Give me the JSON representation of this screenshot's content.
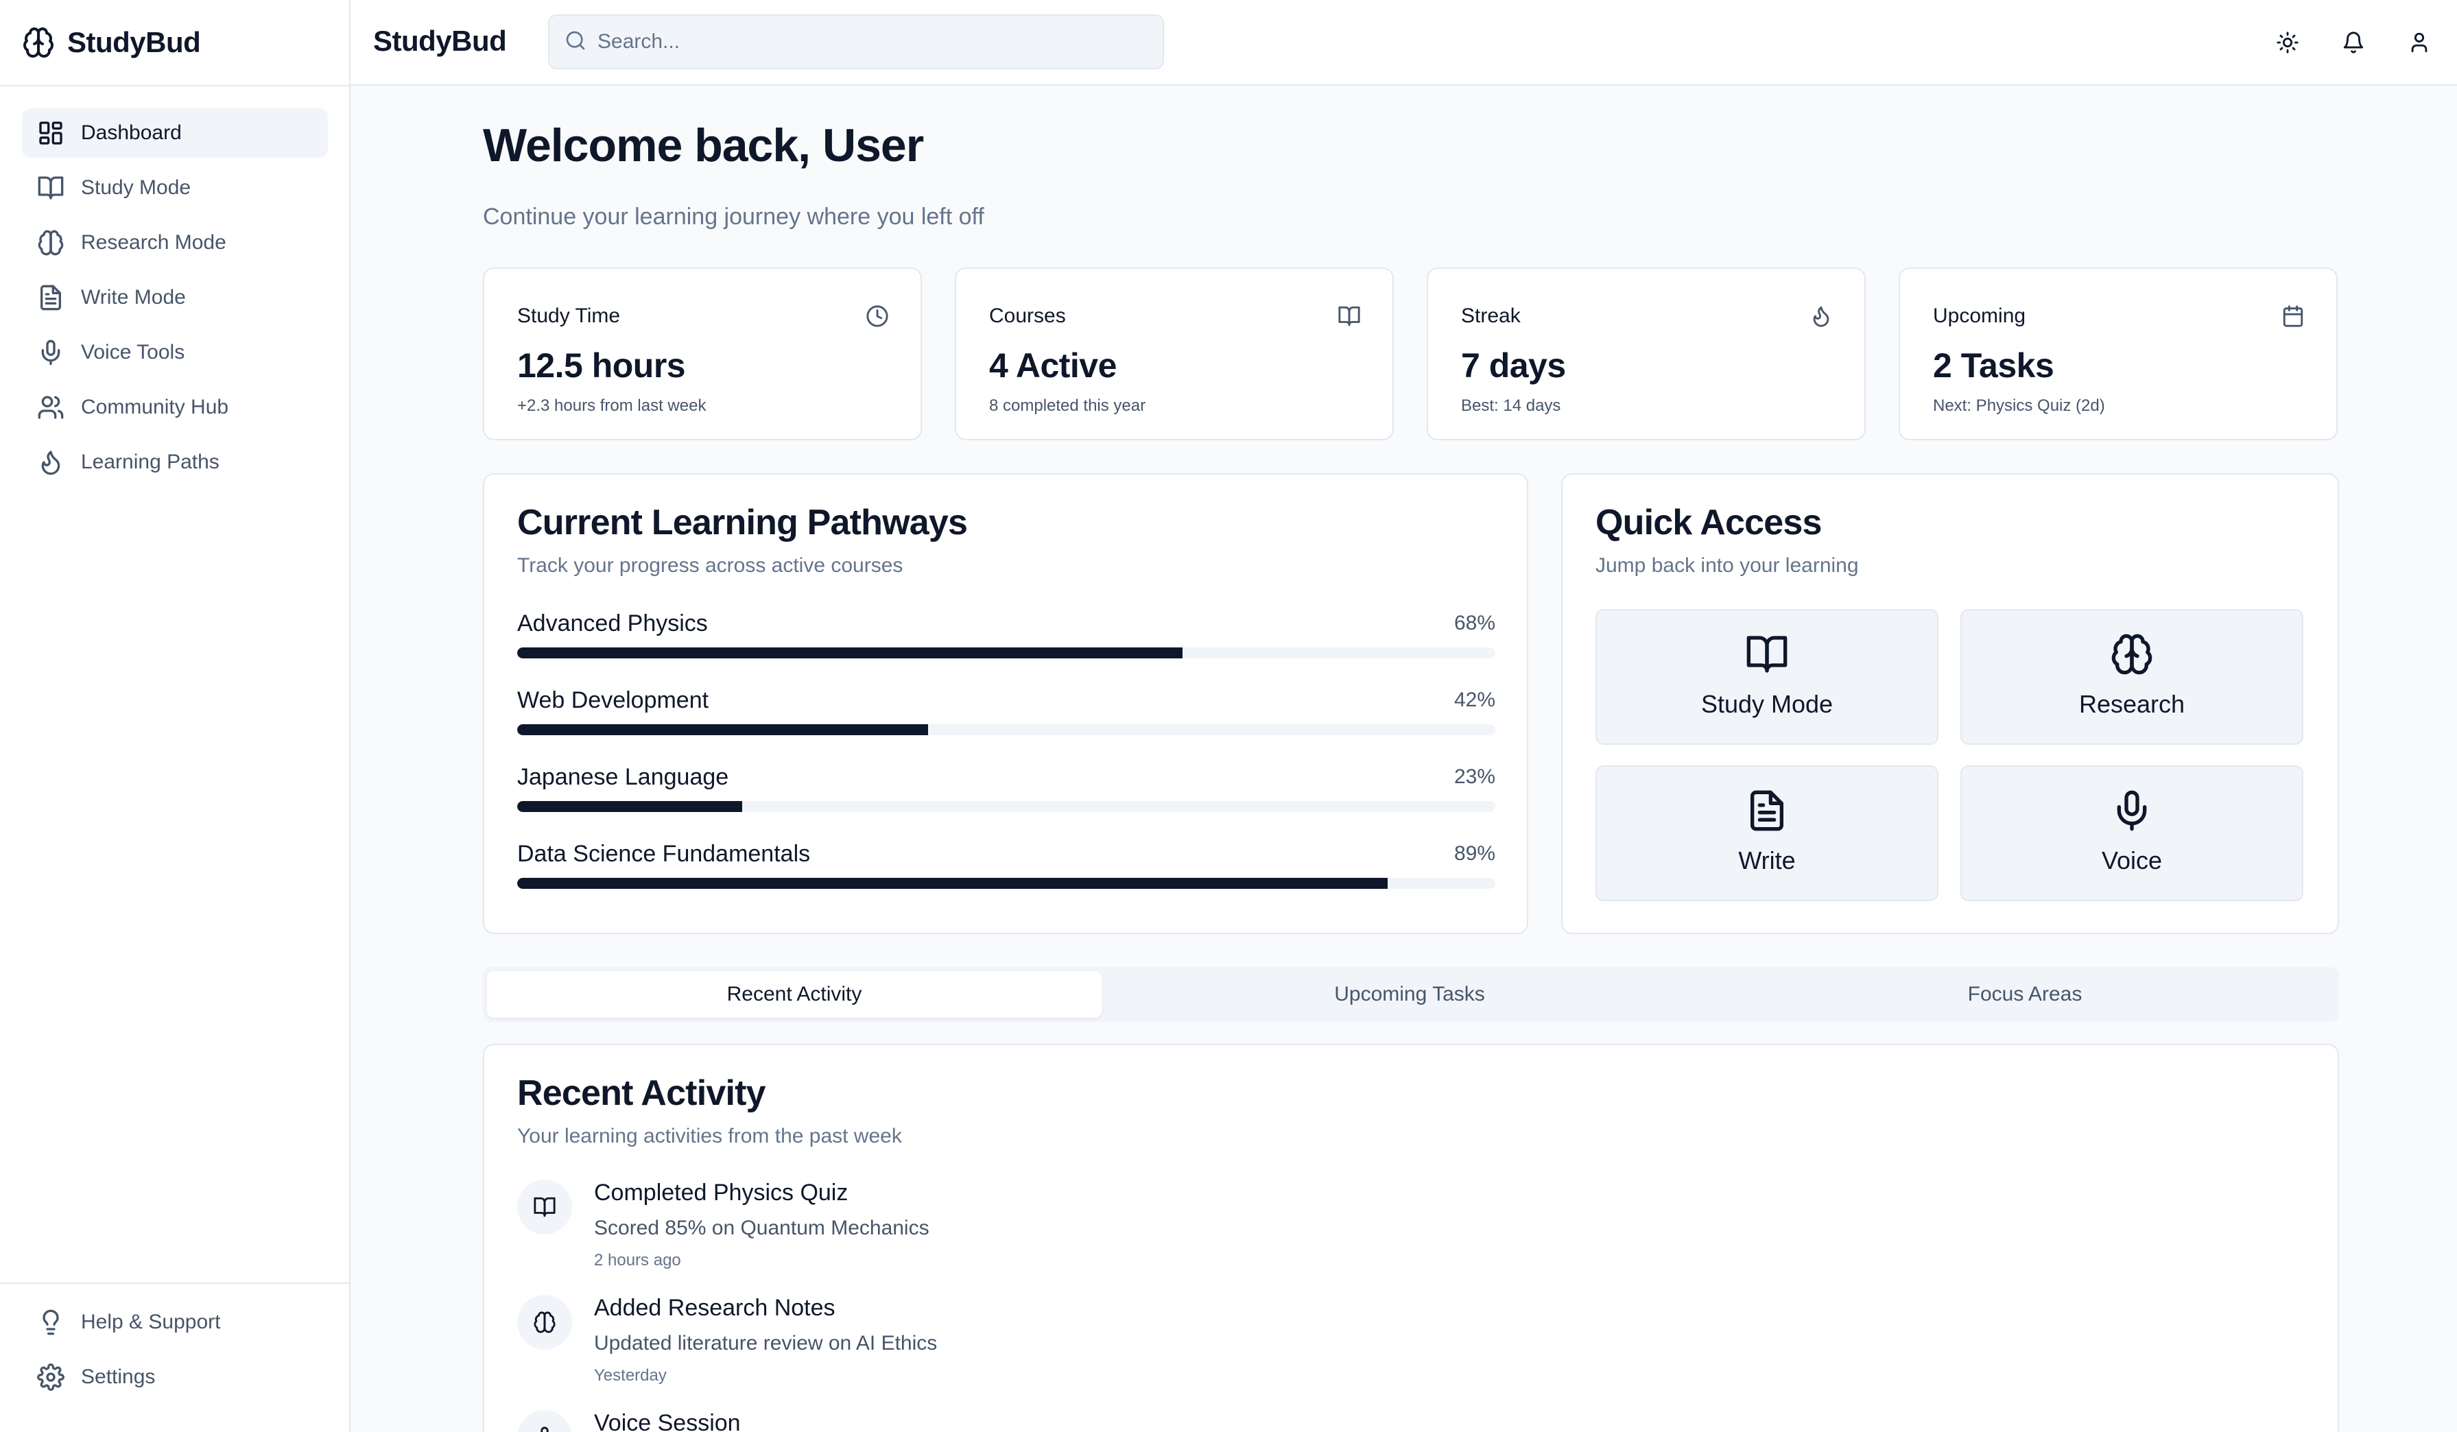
{
  "app": {
    "name": "StudyBud"
  },
  "sidebar": {
    "items": [
      {
        "label": "Dashboard",
        "icon": "dashboard-icon"
      },
      {
        "label": "Study Mode",
        "icon": "book-icon"
      },
      {
        "label": "Research Mode",
        "icon": "brain-icon"
      },
      {
        "label": "Write Mode",
        "icon": "document-icon"
      },
      {
        "label": "Voice Tools",
        "icon": "microphone-icon"
      },
      {
        "label": "Community Hub",
        "icon": "users-icon"
      },
      {
        "label": "Learning Paths",
        "icon": "flame-icon"
      }
    ],
    "active": "Dashboard",
    "bottom": [
      {
        "label": "Help & Support",
        "icon": "lightbulb-icon"
      },
      {
        "label": "Settings",
        "icon": "gear-icon"
      }
    ]
  },
  "header": {
    "title": "StudyBud",
    "search_placeholder": "Search...",
    "icons": [
      "sun-icon",
      "bell-icon",
      "user-icon"
    ]
  },
  "welcome": {
    "title": "Welcome back, User",
    "subtitle": "Continue your learning journey where you left off"
  },
  "stats": [
    {
      "label": "Study Time",
      "value": "12.5 hours",
      "note": "+2.3 hours from last week",
      "icon": "clock-icon"
    },
    {
      "label": "Courses",
      "value": "4 Active",
      "note": "8 completed this year",
      "icon": "book-icon"
    },
    {
      "label": "Streak",
      "value": "7 days",
      "note": "Best: 14 days",
      "icon": "flame-icon"
    },
    {
      "label": "Upcoming",
      "value": "2 Tasks",
      "note": "Next: Physics Quiz (2d)",
      "icon": "calendar-icon"
    }
  ],
  "pathways": {
    "title": "Current Learning Pathways",
    "subtitle": "Track your progress across active courses",
    "items": [
      {
        "name": "Advanced Physics",
        "percent_label": "68%",
        "progress": 68
      },
      {
        "name": "Web Development",
        "percent_label": "42%",
        "progress": 42
      },
      {
        "name": "Japanese Language",
        "percent_label": "23%",
        "progress": 23
      },
      {
        "name": "Data Science Fundamentals",
        "percent_label": "89%",
        "progress": 89
      }
    ]
  },
  "quick_access": {
    "title": "Quick Access",
    "subtitle": "Jump back into your learning",
    "buttons": [
      {
        "label": "Study Mode",
        "icon": "book-icon"
      },
      {
        "label": "Research",
        "icon": "brain-icon"
      },
      {
        "label": "Write",
        "icon": "document-icon"
      },
      {
        "label": "Voice",
        "icon": "microphone-icon"
      }
    ]
  },
  "tabs": {
    "items": [
      "Recent Activity",
      "Upcoming Tasks",
      "Focus Areas"
    ],
    "active": "Recent Activity"
  },
  "recent_activity": {
    "title": "Recent Activity",
    "subtitle": "Your learning activities from the past week",
    "items": [
      {
        "title": "Completed Physics Quiz",
        "detail": "Scored 85% on Quantum Mechanics",
        "time": "2 hours ago",
        "icon": "book-icon"
      },
      {
        "title": "Added Research Notes",
        "detail": "Updated literature review on AI Ethics",
        "time": "Yesterday",
        "icon": "brain-icon"
      },
      {
        "title": "Voice Session",
        "detail": "",
        "time": "",
        "icon": "microphone-icon"
      }
    ]
  },
  "colors": {
    "accent": "#0f172a",
    "muted_text": "#64748b",
    "background": "#f8fafc",
    "surface": "#ffffff",
    "border": "#e2e8f0",
    "track": "#f1f5f9"
  }
}
